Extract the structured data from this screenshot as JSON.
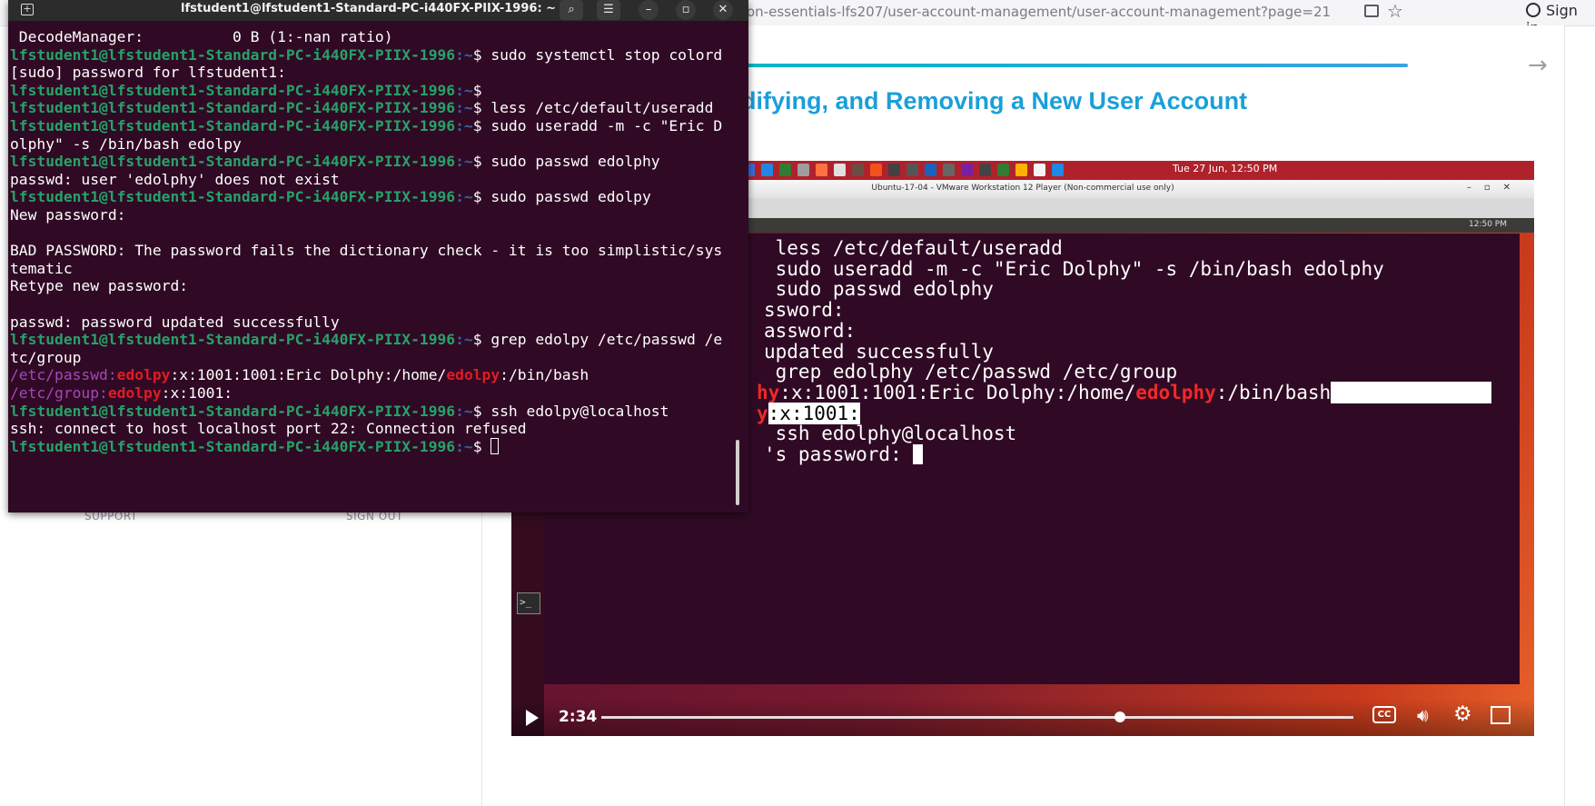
{
  "browser": {
    "url": "on-essentials-lfs207/user-account-management/user-account-management?page=21",
    "sign_in": "Sign in"
  },
  "page": {
    "lesson_title": "difying, and Removing a New User Account",
    "support": "SUPPORT",
    "sign_out": "SIGN OUT"
  },
  "terminal": {
    "title": "lfstudent1@lfstudent1-Standard-PC-i440FX-PIIX-1996: ~",
    "prompt_user": "lfstudent1@lfstudent1-Standard-PC-i440FX-PIIX-1996",
    "prompt_path": ":~",
    "lines": [
      {
        "type": "text",
        "text": " DecodeManager:          0 B (1:-nan ratio)"
      },
      {
        "type": "cmd",
        "cmd": "sudo systemctl stop colord"
      },
      {
        "type": "text",
        "text": "[sudo] password for lfstudent1:"
      },
      {
        "type": "cmd",
        "cmd": ""
      },
      {
        "type": "cmd",
        "cmd": "less /etc/default/useradd"
      },
      {
        "type": "cmd",
        "cmd": "sudo useradd -m -c \"Eric D"
      },
      {
        "type": "text",
        "text": "olphy\" -s /bin/bash edolpy"
      },
      {
        "type": "cmd",
        "cmd": "sudo passwd edolphy"
      },
      {
        "type": "text",
        "text": "passwd: user 'edolphy' does not exist"
      },
      {
        "type": "cmd",
        "cmd": "sudo passwd edolpy"
      },
      {
        "type": "text",
        "text": "New password:"
      },
      {
        "type": "text",
        "text": ""
      },
      {
        "type": "text",
        "text": "BAD PASSWORD: The password fails the dictionary check - it is too simplistic/sys"
      },
      {
        "type": "text",
        "text": "tematic"
      },
      {
        "type": "text",
        "text": "Retype new password:"
      },
      {
        "type": "text",
        "text": ""
      },
      {
        "type": "text",
        "text": "passwd: password updated successfully"
      },
      {
        "type": "cmd",
        "cmd": "grep edolpy /etc/passwd /e"
      },
      {
        "type": "text",
        "text": "tc/group"
      },
      {
        "type": "grep",
        "file": "/etc/passwd:",
        "match": "edolpy",
        "rest": ":x:1001:1001:Eric Dolphy:/home/",
        "match2": "edolpy",
        "rest2": ":/bin/bash"
      },
      {
        "type": "grep",
        "file": "/etc/group:",
        "match": "edolpy",
        "rest": ":x:1001:",
        "match2": "",
        "rest2": ""
      },
      {
        "type": "cmd",
        "cmd": "ssh edolpy@localhost"
      },
      {
        "type": "text",
        "text": "ssh: connect to host localhost port 22: Connection refused"
      },
      {
        "type": "cmd",
        "cmd": "",
        "cursor": true
      }
    ]
  },
  "video": {
    "time": "2:34",
    "progress": 0.69,
    "cc_label": "CC",
    "vm_clock": "Tue 27 Jun, 12:50 PM",
    "vm_window_title": "Ubuntu-17-04 - VMware Workstation 12 Player (Non-commercial use only)",
    "vm_inner_clock": "12:50 PM",
    "vm_lines": [
      {
        "a": " less /etc/default/useradd"
      },
      {
        "a": " sudo useradd -m -c \"Eric Dolphy\" -s /bin/bash edolphy"
      },
      {
        "a": " sudo passwd edolphy"
      },
      {
        "a": "ssword:"
      },
      {
        "a": "assword:"
      },
      {
        "a": "updated successfully"
      },
      {
        "a": " grep edolphy /etc/passwd /etc/group"
      },
      {
        "a": "hy:x:1001:1001:Eric Dolphy:/home/edolphy:/bin/bash"
      },
      {
        "a": "y:x:1001:"
      },
      {
        "a": " ssh edolphy@localhost"
      },
      {
        "a": "'s password: "
      }
    ]
  }
}
